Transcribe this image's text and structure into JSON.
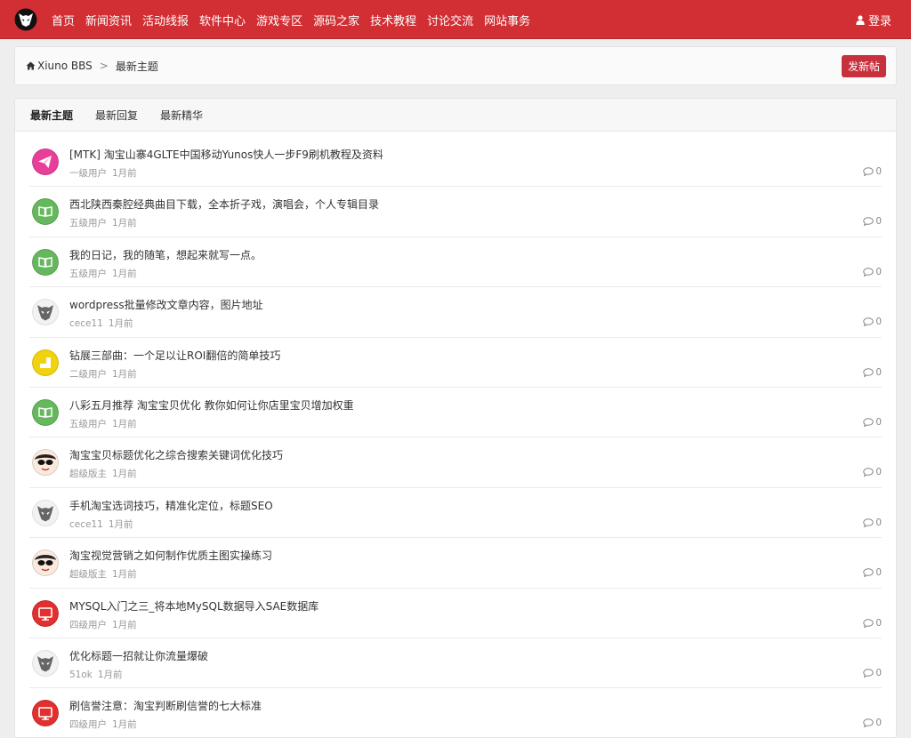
{
  "nav": {
    "items": [
      {
        "label": "首页"
      },
      {
        "label": "新闻资讯"
      },
      {
        "label": "活动线报"
      },
      {
        "label": "软件中心"
      },
      {
        "label": "游戏专区"
      },
      {
        "label": "源码之家"
      },
      {
        "label": "技术教程"
      },
      {
        "label": "讨论交流"
      },
      {
        "label": "网站事务"
      }
    ],
    "login_label": "登录"
  },
  "breadcrumb": {
    "home": "Xiuno BBS",
    "separator": ">",
    "current": "最新主题"
  },
  "new_thread_label": "发新帖",
  "tabs": [
    {
      "label": "最新主题",
      "active": true
    },
    {
      "label": "最新回复",
      "active": false
    },
    {
      "label": "最新精华",
      "active": false
    }
  ],
  "colors": {
    "brand": "#d12f34",
    "button": "#c8303c"
  },
  "threads": [
    {
      "title": "[MTK] 淘宝山寨4GLTE中国移动Yunos快人一步F9刷机教程及资料",
      "user": "一级用户",
      "time": "1月前",
      "replies": "0",
      "avatar": "pink-paperplane"
    },
    {
      "title": "西北陕西秦腔经典曲目下载，全本折子戏，演唱会，个人专辑目录",
      "user": "五级用户",
      "time": "1月前",
      "replies": "0",
      "avatar": "green-book"
    },
    {
      "title": "我的日记，我的随笔，想起来就写一点。",
      "user": "五级用户",
      "time": "1月前",
      "replies": "0",
      "avatar": "green-book"
    },
    {
      "title": "wordpress批量修改文章内容，图片地址",
      "user": "cece11",
      "time": "1月前",
      "replies": "0",
      "avatar": "grey-mask"
    },
    {
      "title": "钻展三部曲：一个足以让ROI翻倍的简单技巧",
      "user": "二级用户",
      "time": "1月前",
      "replies": "0",
      "avatar": "yellow-square"
    },
    {
      "title": "八彩五月推荐 淘宝宝贝优化 教你如何让你店里宝贝增加权重",
      "user": "五级用户",
      "time": "1月前",
      "replies": "0",
      "avatar": "green-book"
    },
    {
      "title": "淘宝宝贝标题优化之综合搜索关键词优化技巧",
      "user": "超级版主",
      "time": "1月前",
      "replies": "0",
      "avatar": "cartoon-face"
    },
    {
      "title": "手机淘宝选词技巧，精准化定位，标题SEO",
      "user": "cece11",
      "time": "1月前",
      "replies": "0",
      "avatar": "grey-mask"
    },
    {
      "title": "淘宝视觉营销之如何制作优质主图实操练习",
      "user": "超级版主",
      "time": "1月前",
      "replies": "0",
      "avatar": "cartoon-face"
    },
    {
      "title": "MYSQL入门之三_将本地MySQL数据导入SAE数据库",
      "user": "四级用户",
      "time": "1月前",
      "replies": "0",
      "avatar": "red-monitor"
    },
    {
      "title": "优化标题一招就让你流量爆破",
      "user": "51ok",
      "time": "1月前",
      "replies": "0",
      "avatar": "grey-mask"
    },
    {
      "title": "刷信誉注意：淘宝判断刷信誉的七大标准",
      "user": "四级用户",
      "time": "1月前",
      "replies": "0",
      "avatar": "red-monitor"
    }
  ]
}
